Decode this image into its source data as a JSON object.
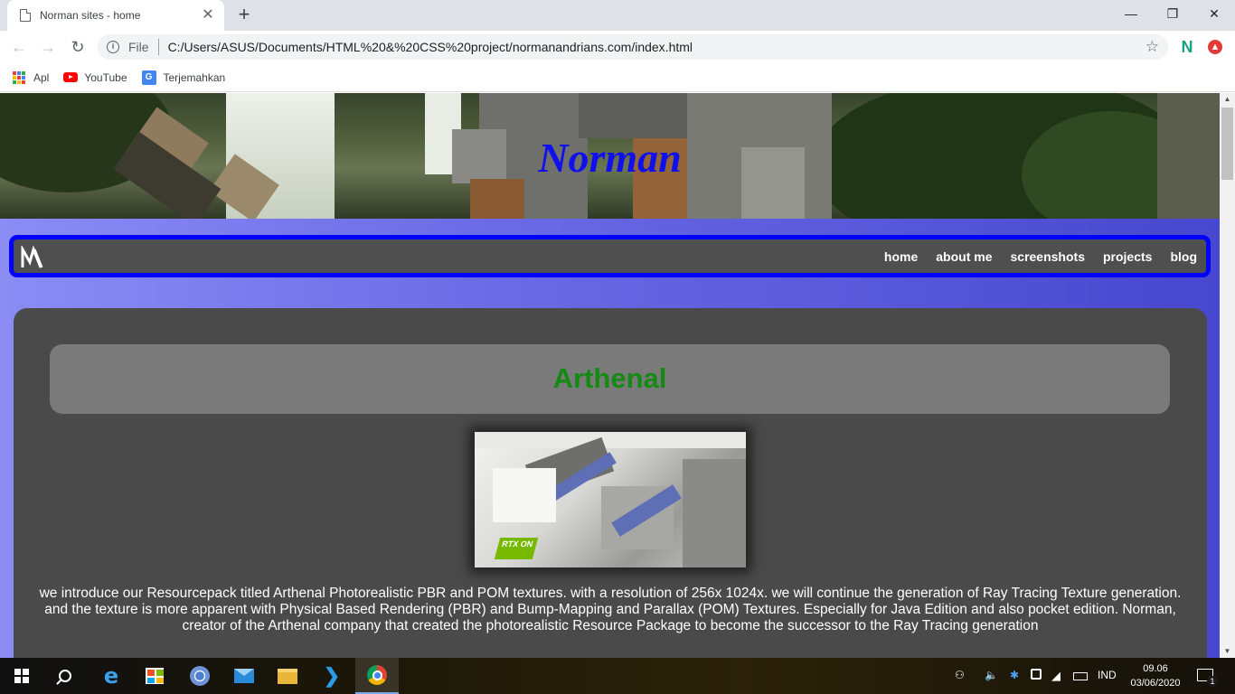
{
  "browser": {
    "tab_title": "Norman sites - home",
    "tab_close": "✕",
    "new_tab": "+",
    "window_controls": {
      "minimize": "—",
      "restore": "❐",
      "close": "✕"
    },
    "nav": {
      "back": "←",
      "forward": "→",
      "reload": "↻"
    },
    "omnibox": {
      "info": "i",
      "scheme_label": "File",
      "url": "C:/Users/ASUS/Documents/HTML%20&%20CSS%20project/normanandrians.com/index.html",
      "star": "☆"
    },
    "extensions": {
      "n_label": "N",
      "red_label": "▲"
    },
    "bookmarks": [
      {
        "label": "Apl",
        "icon": "apps-grid-icon"
      },
      {
        "label": "YouTube",
        "icon": "youtube-icon"
      },
      {
        "label": "Terjemahkan",
        "icon": "google-translate-icon"
      }
    ],
    "apps_colors": [
      "#ea4335",
      "#4285f4",
      "#34a853",
      "#fbbc05",
      "#ea4335",
      "#4285f4",
      "#34a853",
      "#fbbc05",
      "#ea4335"
    ],
    "translate_glyph": "G"
  },
  "page": {
    "hero_title": "Norman",
    "nav_links": [
      "home",
      "about me",
      "screenshots",
      "projects",
      "blog"
    ],
    "card": {
      "title": "Arthenal",
      "rtx_badge": "RTX ON",
      "description": "we introduce our Resourcepack titled Arthenal Photorealistic PBR and POM textures. with a resolution of 256x 1024x. we will continue the generation of Ray Tracing Texture generation. and the texture is more apparent with Physical Based Rendering (PBR) and Bump-Mapping and Parallax (POM) Textures. Especially for Java Edition and also pocket edition. Norman, creator of the Arthenal company that created the photorealistic Resource Package to become the successor to the Ray Tracing generation"
    },
    "colors": {
      "hero_title": "#1010ee",
      "navbar_border": "#0000ff",
      "card_title": "#148a14"
    }
  },
  "scrollbar": {
    "up": "▲",
    "down": "▼"
  },
  "taskbar": {
    "ie_glyph": "e",
    "vscode_glyph": "❯",
    "tray": {
      "people": "⚇",
      "volume": "🔈",
      "bluetooth": "✱",
      "language": "IND"
    },
    "clock_time": "09.06",
    "clock_date": "03/06/2020",
    "notification_count": "1"
  }
}
